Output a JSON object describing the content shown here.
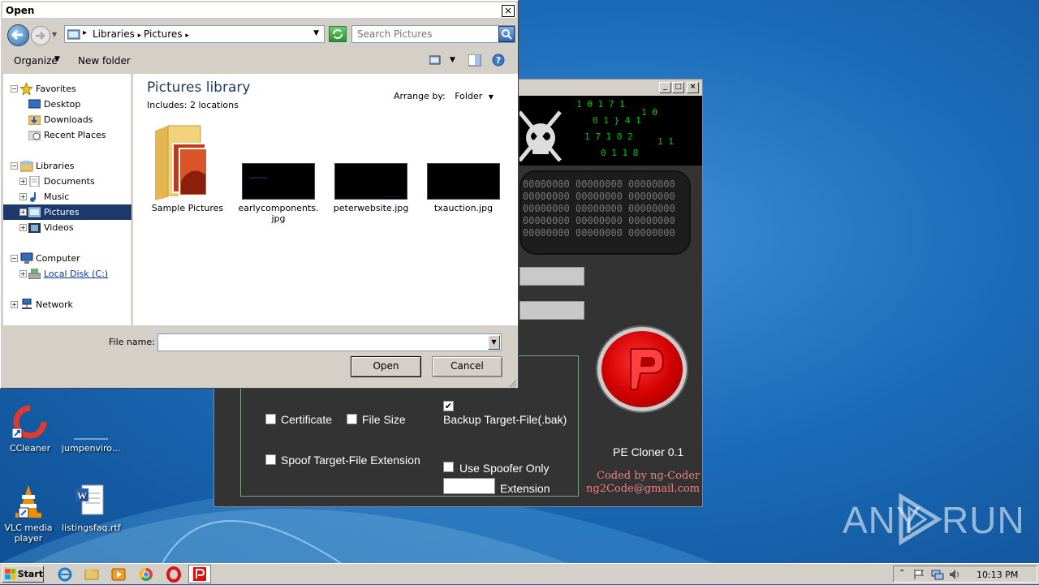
{
  "open_dialog": {
    "title": "Open",
    "breadcrumb": [
      "Libraries",
      "Pictures"
    ],
    "search_placeholder": "Search Pictures",
    "organize_label": "Organize",
    "new_folder_label": "New folder",
    "nav": {
      "favorites": "Favorites",
      "desktop": "Desktop",
      "downloads": "Downloads",
      "recent_places": "Recent Places",
      "libraries": "Libraries",
      "documents": "Documents",
      "music": "Music",
      "pictures": "Pictures",
      "videos": "Videos",
      "computer": "Computer",
      "local_disk": "Local Disk (C:)",
      "network": "Network"
    },
    "library_title": "Pictures library",
    "includes_label": "Includes:",
    "includes_link": "2 locations",
    "arrange_by_label": "Arrange by:",
    "arrange_by_value": "Folder",
    "files": [
      {
        "name": "Sample Pictures",
        "type": "folder"
      },
      {
        "name": "earlycomponents.jpg",
        "type": "image"
      },
      {
        "name": "peterwebsite.jpg",
        "type": "image"
      },
      {
        "name": "txauction.jpg",
        "type": "image"
      }
    ],
    "file_name_label": "File name:",
    "file_name_value": "",
    "open_button": "Open",
    "cancel_button": "Cancel"
  },
  "pe_cloner": {
    "matrix_text": "00000000 00000000 00000000\n00000000 00000000 00000000\n00000000 00000000 00000000\n00000000 00000000 00000000\n00000000 00000000 00000000",
    "certificate_label": "Certificate",
    "certificate_checked": false,
    "file_size_label": "File Size",
    "file_size_checked": false,
    "backup_label": "Backup Target-File(.bak)",
    "backup_checked": true,
    "spoof_label": "Spoof Target-File Extension",
    "spoof_checked": false,
    "use_spoofer_label": "Use Spoofer Only",
    "use_spoofer_checked": false,
    "extension_label": "Extension",
    "extension_value": "",
    "app_name": "PE Cloner 0.1",
    "coded_by": "Coded by ng-Coder",
    "email": "ng2Code@gmail.com"
  },
  "desktop_icons": [
    {
      "label": "CCleaner"
    },
    {
      "label": "jumpenviro..."
    },
    {
      "label": "VLC media player"
    },
    {
      "label": "listingsfaq.rtf"
    }
  ],
  "taskbar": {
    "start_label": "Start",
    "clock": "10:13 PM"
  },
  "watermark": "ANY RUN"
}
